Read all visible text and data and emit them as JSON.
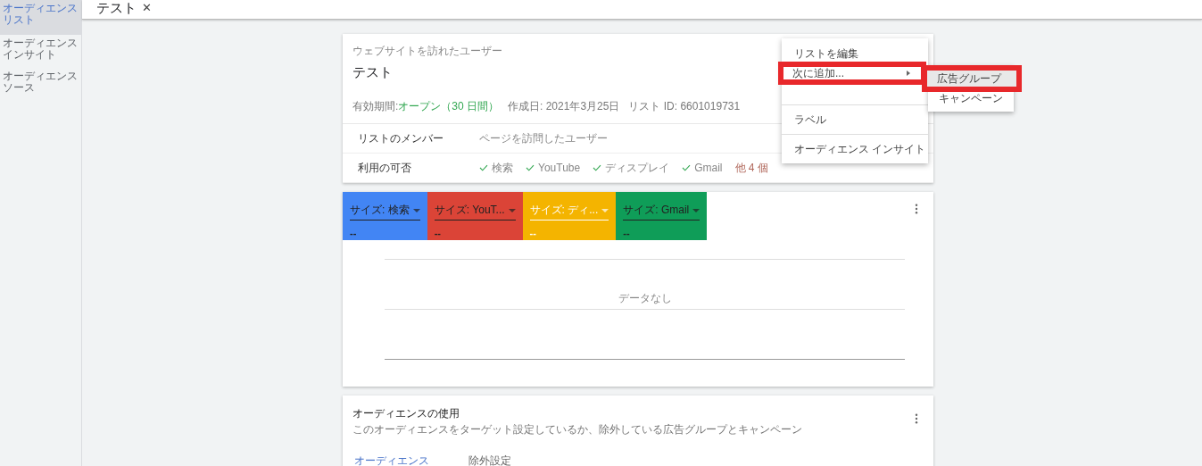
{
  "sidebar": {
    "items": [
      {
        "label": "オーディエンスリスト",
        "selected": true
      },
      {
        "label": "オーディエンスインサイト",
        "selected": false
      },
      {
        "label": "オーディエンスソース",
        "selected": false
      }
    ]
  },
  "header": {
    "title": "テスト",
    "close": "✕"
  },
  "list_card": {
    "category": "ウェブサイトを訪れたユーザー",
    "title": "テスト",
    "meta": {
      "duration_label": "有効期間:",
      "duration_value": "オープン（30 日間）",
      "created": "作成日: 2021年3月25日",
      "list_id": "リスト ID: 6601019731"
    },
    "members": {
      "label": "リストのメンバー",
      "value": "ページを訪問したユーザー"
    },
    "availability": {
      "label": "利用の可否",
      "networks": [
        {
          "name": "検索",
          "available": true
        },
        {
          "name": "YouTube",
          "available": true
        },
        {
          "name": "ディスプレイ",
          "available": true
        },
        {
          "name": "Gmail",
          "available": true
        }
      ],
      "more": "他 4 個"
    }
  },
  "context_menu": {
    "groups": [
      [
        {
          "label": "リストを編集",
          "has_submenu": false,
          "highlighted": false
        },
        {
          "label": "次に追加...",
          "has_submenu": true,
          "highlighted": true
        }
      ],
      [
        {
          "label": "ラベル",
          "has_submenu": false,
          "highlighted": false
        }
      ],
      [
        {
          "label": "オーディエンス インサイト",
          "has_submenu": false,
          "highlighted": false
        }
      ]
    ],
    "submenu": [
      {
        "label": "広告グループ",
        "selected": true,
        "highlighted": true
      },
      {
        "label": "キャンペーン",
        "selected": false,
        "highlighted": false
      }
    ]
  },
  "size_card": {
    "tiles": [
      {
        "label": "サイズ: 検索",
        "value": "--",
        "color": "#4285f4"
      },
      {
        "label": "サイズ: YouT...",
        "value": "--",
        "color": "#db4437"
      },
      {
        "label": "サイズ: ディ...",
        "value": "--",
        "color": "#f4b400"
      },
      {
        "label": "サイズ: Gmail",
        "value": "--",
        "color": "#0f9d58"
      }
    ],
    "empty_message": "データなし"
  },
  "usage_card": {
    "title": "オーディエンスの使用",
    "subtitle": "このオーディエンスをターゲット設定しているか、除外している広告グループとキャンペーン",
    "tabs": [
      {
        "label": "オーディエンス",
        "selected": true
      },
      {
        "label": "除外設定",
        "selected": false
      }
    ]
  }
}
